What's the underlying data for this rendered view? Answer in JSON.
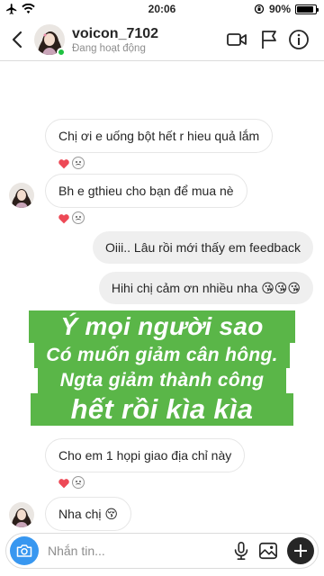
{
  "status_bar": {
    "time": "20:06",
    "battery_text": "90%",
    "battery_level": 0.9
  },
  "header": {
    "username": "voicon_7102",
    "status": "Đang hoạt động"
  },
  "messages": [
    {
      "side": "in",
      "text": "Chị ơi e uống bột hết r hieu quả lắm",
      "reactions": [
        "heart-icon",
        "face-icon"
      ],
      "avatar": false
    },
    {
      "side": "in",
      "text": "Bh e gthieu cho bạn để mua nè",
      "reactions": [
        "heart-icon",
        "face-icon"
      ],
      "avatar": true
    },
    {
      "side": "out",
      "text": "Oiii.. Lâu rồi mới thấy em feedback"
    },
    {
      "side": "out",
      "text": "Hihi chị cảm ơn nhiều nha 😘😘😘"
    },
    {
      "side": "in",
      "text": "Cho em 1 họpi giao địa chỉ này",
      "reactions": [
        "heart-icon",
        "face-icon"
      ],
      "avatar": false
    },
    {
      "side": "in",
      "text": "Nha chị 😚",
      "avatar": true
    }
  ],
  "overlay": {
    "line1": "Ý mọi người sao",
    "line2": "Có muốn giảm cân hông.",
    "line3": "Ngta giảm thành công",
    "line4": "hết rồi kìa kìa"
  },
  "composer": {
    "placeholder": "Nhắn tin..."
  },
  "colors": {
    "accent": "#3897f0",
    "online": "#1ec140",
    "overlay_green": "#5ab648",
    "heart": "#ed4956"
  },
  "icons": {
    "back": "chevron-left-icon",
    "video": "video-camera-icon",
    "flag": "flag-icon",
    "info": "info-icon",
    "camera": "camera-icon",
    "mic": "microphone-icon",
    "gallery": "gallery-icon",
    "plus": "plus-icon"
  }
}
